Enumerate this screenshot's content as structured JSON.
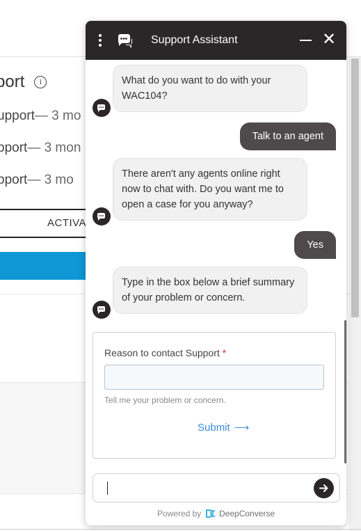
{
  "background": {
    "section_title": "port",
    "lines": [
      {
        "a": "upport",
        "b": "— 3 mo"
      },
      {
        "a": "pport",
        "b": "— 3 mon"
      },
      {
        "a": "pport",
        "b": "— 3 mo"
      }
    ],
    "tab_label": "ACTIVA"
  },
  "chat": {
    "title": "Support Assistant",
    "messages": [
      {
        "from": "bot",
        "text": "What do you want to do with your WAC104?"
      },
      {
        "from": "user",
        "text": "Talk to an agent"
      },
      {
        "from": "bot",
        "text": "There aren't any agents online right now to chat with. Do you want me to open a case for you anyway?"
      },
      {
        "from": "user",
        "text": "Yes"
      },
      {
        "from": "bot",
        "text": "Type in the box below a brief summary of your problem or concern."
      }
    ],
    "form": {
      "label": "Reason to contact Support",
      "required_mark": "*",
      "input_value": "",
      "help_text": "Tell me your problem or concern.",
      "submit_label": "Submit"
    },
    "composer": {
      "value": "",
      "placeholder": ""
    },
    "footer": {
      "prefix": "Powered by",
      "brand": "DeepConverse"
    },
    "colors": {
      "header": "#2b2628",
      "user_bubble": "#4e4a4c",
      "bot_bubble": "#f1f1f1",
      "link": "#3a8fd9",
      "bg_blue_bar": "#0f97d6"
    }
  }
}
